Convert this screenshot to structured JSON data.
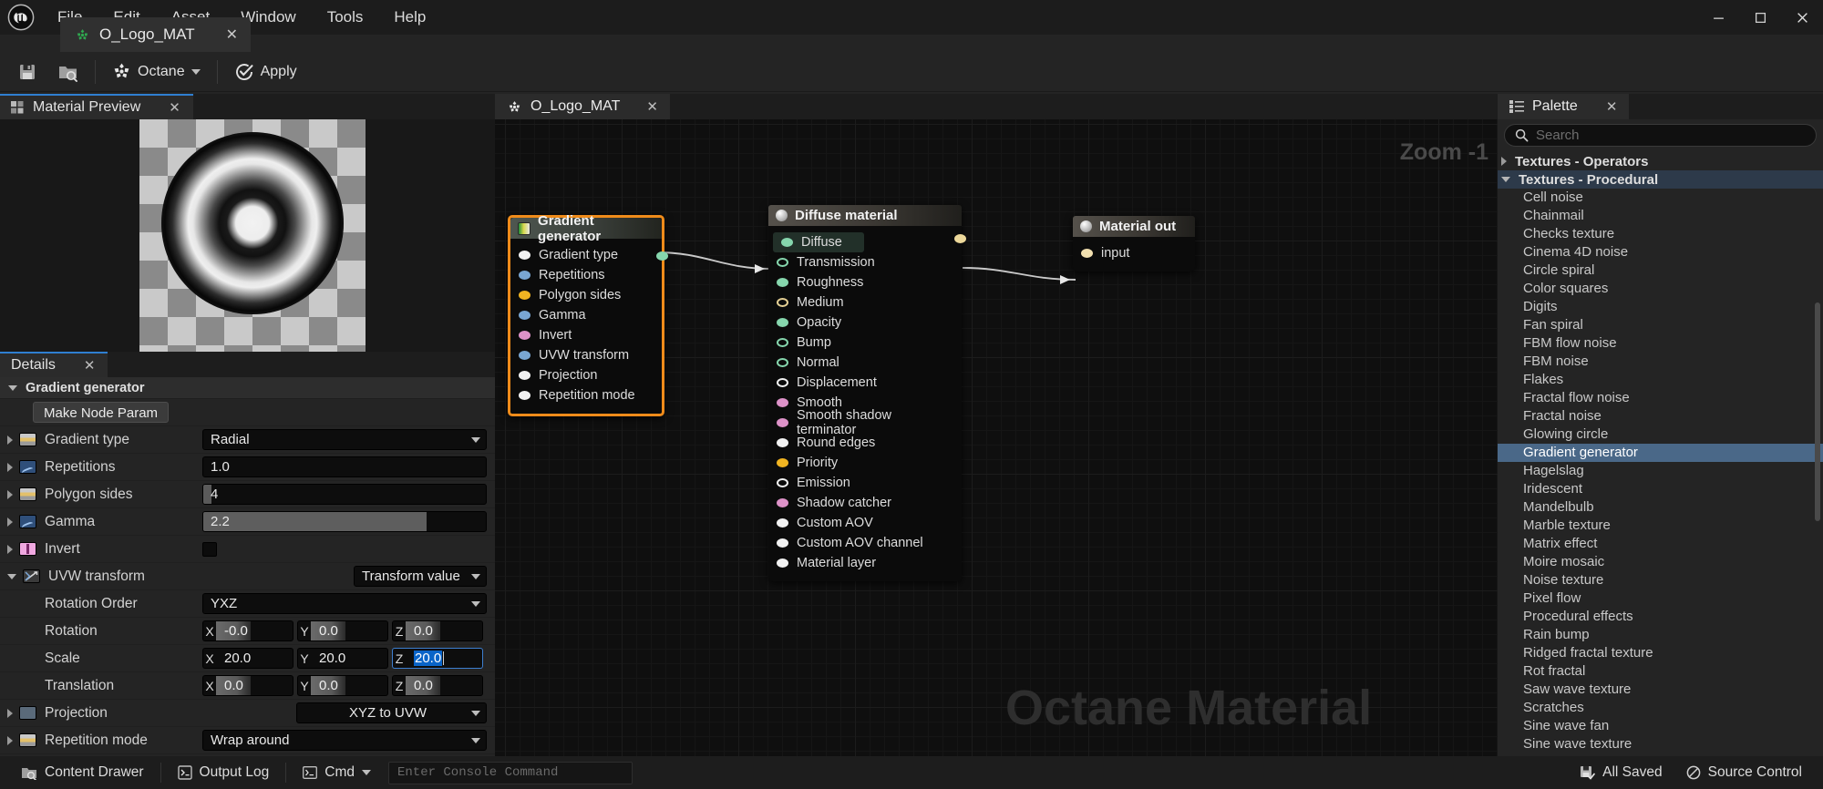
{
  "window": {
    "menus": [
      "File",
      "Edit",
      "Asset",
      "Window",
      "Tools",
      "Help"
    ],
    "controls": {
      "minimize": "—",
      "maximize": "▢",
      "close": "✕"
    }
  },
  "doc_tab": {
    "label": "O_Logo_MAT",
    "close": "✕",
    "icon": "octane-icon"
  },
  "toolbar": {
    "save_label": "",
    "browse_label": "",
    "octane_label": "Octane",
    "apply_label": "Apply"
  },
  "material_preview": {
    "tab_label": "Material Preview",
    "close": "✕"
  },
  "details": {
    "tab_label": "Details",
    "close": "✕",
    "section_title": "Gradient generator",
    "make_node_param": "Make Node Param",
    "rows": [
      {
        "label": "Gradient type",
        "value": "Radial",
        "kind": "dropdown",
        "type": "enum"
      },
      {
        "label": "Repetitions",
        "value": "1.0",
        "kind": "text",
        "type": "float"
      },
      {
        "label": "Polygon sides",
        "value": "4",
        "kind": "slider-small",
        "type": "enum"
      },
      {
        "label": "Gamma",
        "value": "2.2",
        "kind": "slider-wide",
        "type": "float"
      },
      {
        "label": "Invert",
        "value": "",
        "kind": "checkbox",
        "type": "bool"
      },
      {
        "label": "UVW transform",
        "value": "Transform value",
        "kind": "dropdown-right",
        "type": "transform"
      }
    ],
    "rotation_order": {
      "label": "Rotation Order",
      "value": "YXZ"
    },
    "rotation": {
      "label": "Rotation",
      "x": "-0.0",
      "y": "0.0",
      "z": "0.0"
    },
    "scale": {
      "label": "Scale",
      "x": "20.0",
      "y": "20.0",
      "z": "20.0"
    },
    "translation": {
      "label": "Translation",
      "x": "0.0",
      "y": "0.0",
      "z": "0.0"
    },
    "projection": {
      "label": "Projection",
      "value": "XYZ to UVW"
    },
    "repetition_mode": {
      "label": "Repetition mode",
      "value": "Wrap around"
    },
    "axis_labels": {
      "x": "X",
      "y": "Y",
      "z": "Z"
    }
  },
  "graph": {
    "tab_label": "O_Logo_MAT",
    "close": "✕",
    "zoom_label": "Zoom -1",
    "watermark": "Octane Material",
    "nodes": [
      {
        "title": "Gradient generator",
        "selected": true,
        "pins": [
          {
            "label": "Gradient type",
            "color": "#f2f2f2",
            "filled": true
          },
          {
            "label": "Repetitions",
            "color": "#79a6d2",
            "filled": true
          },
          {
            "label": "Polygon sides",
            "color": "#f0b422",
            "filled": true
          },
          {
            "label": "Gamma",
            "color": "#79a6d2",
            "filled": true
          },
          {
            "label": "Invert",
            "color": "#dd92c8",
            "filled": true
          },
          {
            "label": "UVW transform",
            "color": "#79a6d2",
            "filled": true
          },
          {
            "label": "Projection",
            "color": "#f2f2f2",
            "filled": true
          },
          {
            "label": "Repetition mode",
            "color": "#f2f2f2",
            "filled": true
          }
        ],
        "output_color": "#86d6ad"
      },
      {
        "title": "Diffuse material",
        "selected": false,
        "pins": [
          {
            "label": "Diffuse",
            "color": "#86d6ad",
            "filled": true,
            "highlight": true
          },
          {
            "label": "Transmission",
            "color": "#86d6ad",
            "filled": false
          },
          {
            "label": "Roughness",
            "color": "#86d6ad",
            "filled": true
          },
          {
            "label": "Medium",
            "color": "#e4cf94",
            "filled": false
          },
          {
            "label": "Opacity",
            "color": "#86d6ad",
            "filled": true
          },
          {
            "label": "Bump",
            "color": "#86d6ad",
            "filled": false
          },
          {
            "label": "Normal",
            "color": "#86d6ad",
            "filled": false
          },
          {
            "label": "Displacement",
            "color": "#f2f2f2",
            "filled": false
          },
          {
            "label": "Smooth",
            "color": "#dd92c8",
            "filled": true
          },
          {
            "label": "Smooth shadow terminator",
            "color": "#dd92c8",
            "filled": true
          },
          {
            "label": "Round edges",
            "color": "#f2f2f2",
            "filled": true
          },
          {
            "label": "Priority",
            "color": "#f0b422",
            "filled": true
          },
          {
            "label": "Emission",
            "color": "#f2f2f2",
            "filled": false
          },
          {
            "label": "Shadow catcher",
            "color": "#dd92c8",
            "filled": true
          },
          {
            "label": "Custom AOV",
            "color": "#f2f2f2",
            "filled": true
          },
          {
            "label": "Custom AOV channel",
            "color": "#f2f2f2",
            "filled": true
          },
          {
            "label": "Material layer",
            "color": "#f2f2f2",
            "filled": true
          }
        ],
        "output_color": "#ecd89a"
      },
      {
        "title": "Material out",
        "selected": false,
        "pins": [
          {
            "label": "input",
            "color": "#f2e0b0",
            "filled": true
          }
        ],
        "output_color": null
      }
    ]
  },
  "palette": {
    "tab_label": "Palette",
    "close": "✕",
    "search_placeholder": "Search",
    "search_value": "",
    "categories": [
      {
        "label": "Textures - Operators",
        "expanded": false
      },
      {
        "label": "Textures - Procedural",
        "expanded": true
      }
    ],
    "items": [
      "Cell noise",
      "Chainmail",
      "Checks texture",
      "Cinema 4D noise",
      "Circle spiral",
      "Color squares",
      "Digits",
      "Fan spiral",
      "FBM flow noise",
      "FBM noise",
      "Flakes",
      "Fractal flow noise",
      "Fractal noise",
      "Glowing circle",
      "Gradient generator",
      "Hagelslag",
      "Iridescent",
      "Mandelbulb",
      "Marble texture",
      "Matrix effect",
      "Moire mosaic",
      "Noise texture",
      "Pixel flow",
      "Procedural effects",
      "Rain bump",
      "Ridged fractal texture",
      "Rot fractal",
      "Saw wave texture",
      "Scratches",
      "Sine wave fan",
      "Sine wave texture"
    ],
    "selected_item": "Gradient generator"
  },
  "statusbar": {
    "content_drawer": "Content Drawer",
    "output_log": "Output Log",
    "cmd": "Cmd",
    "console_placeholder": "Enter Console Command",
    "all_saved": "All Saved",
    "source_control": "Source Control"
  },
  "colors": {
    "accent_orange": "#ef8b1a",
    "selection_blue": "#4a6888",
    "tab_accent": "#2f7fd1",
    "field_highlight": "#0a64c8"
  }
}
